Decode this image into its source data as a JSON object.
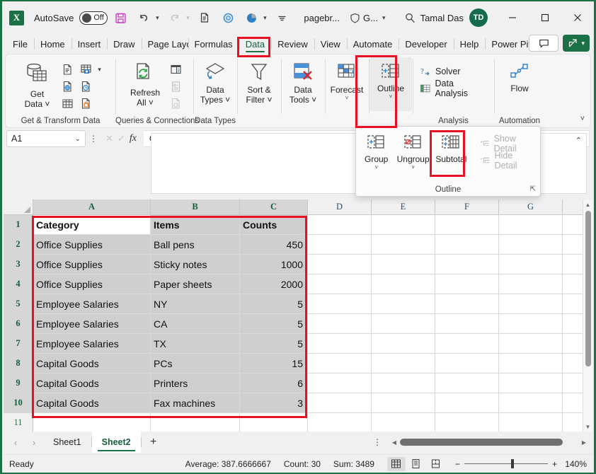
{
  "titlebar": {
    "app_icon": "excel-logo-icon",
    "autosave_label": "AutoSave",
    "autosave_state": "Off",
    "save_icon": "save-icon",
    "undo_icon": "undo-icon",
    "redo_icon": "redo-icon",
    "print_icon": "print-preview-icon",
    "touch_icon": "touch-mode-icon",
    "chart_icon": "pie-chart-icon",
    "more_icon": "more-commands-icon",
    "doc_title": "pagebr...",
    "shield_icon": "shield-icon",
    "autosave_group": "G...",
    "search_icon": "search-icon",
    "user_name": "Tamal Das",
    "user_initials": "TD",
    "minimize": "minimize-icon",
    "maximize": "maximize-icon",
    "close": "close-icon"
  },
  "ribbon_tabs": {
    "items": [
      {
        "label": "File",
        "active": false
      },
      {
        "label": "Home",
        "active": false
      },
      {
        "label": "Insert",
        "active": false
      },
      {
        "label": "Draw",
        "active": false
      },
      {
        "label": "Page Layout",
        "active": false
      },
      {
        "label": "Formulas",
        "active": false
      },
      {
        "label": "Data",
        "active": true
      },
      {
        "label": "Review",
        "active": false
      },
      {
        "label": "View",
        "active": false
      },
      {
        "label": "Automate",
        "active": false
      },
      {
        "label": "Developer",
        "active": false
      },
      {
        "label": "Help",
        "active": false
      },
      {
        "label": "Power Pivot",
        "active": false
      }
    ],
    "comments_label": "comment-icon",
    "share_label": "share-icon"
  },
  "ribbon": {
    "groups": [
      {
        "name": "Get & Transform Data",
        "main_button": {
          "label": "Get\nData",
          "icon": "get-data-icon",
          "has_caret": true
        },
        "small_buttons": [
          "from-text-csv-icon",
          "from-web-icon",
          "from-table-range-icon",
          "from-picture-icon",
          "recent-sources-icon",
          "existing-connections-icon"
        ]
      },
      {
        "name": "Queries & Connections",
        "main_button": {
          "label": "Refresh\nAll",
          "icon": "refresh-all-icon",
          "has_caret": true
        },
        "small_buttons": [
          "queries-connections-icon",
          "properties-icon",
          "edit-links-icon"
        ]
      },
      {
        "name": "Data Types",
        "main_button": {
          "label": "Data\nTypes",
          "icon": "data-types-icon",
          "has_caret": true
        }
      },
      {
        "name": "",
        "main_button": {
          "label": "Sort &\nFilter",
          "icon": "sort-filter-icon",
          "has_caret": true
        }
      },
      {
        "name": "",
        "main_button": {
          "label": "Data\nTools",
          "icon": "data-tools-icon",
          "has_caret": true
        }
      },
      {
        "name": "",
        "main_button": {
          "label": "Forecast",
          "icon": "forecast-icon",
          "has_caret": true
        }
      },
      {
        "name": "",
        "main_button": {
          "label": "Outline",
          "icon": "outline-icon",
          "has_caret": true,
          "highlighted": true
        }
      },
      {
        "name": "Analysis",
        "menu_items": [
          {
            "label": "Solver",
            "icon": "solver-icon",
            "disabled": false
          },
          {
            "label": "Data Analysis",
            "icon": "data-analysis-icon",
            "disabled": false
          }
        ]
      },
      {
        "name": "Automation",
        "main_button": {
          "label": "Flow",
          "icon": "flow-icon",
          "has_caret": false
        }
      }
    ],
    "collapse_icon": "collapse-ribbon-icon"
  },
  "outline_flyout": {
    "group_name": "Outline",
    "buttons": [
      {
        "label": "Group",
        "icon": "group-icon",
        "has_caret": true,
        "disabled": false,
        "highlighted": false
      },
      {
        "label": "Ungroup",
        "icon": "ungroup-icon",
        "has_caret": true,
        "disabled": false,
        "highlighted": false
      },
      {
        "label": "Subtotal",
        "icon": "subtotal-icon",
        "has_caret": false,
        "disabled": false,
        "highlighted": true
      }
    ],
    "menu_items": [
      {
        "label": "Show Detail",
        "icon": "show-detail-icon",
        "disabled": true
      },
      {
        "label": "Hide Detail",
        "icon": "hide-detail-icon",
        "disabled": true
      }
    ],
    "dialog_launcher": "dialog-launcher-icon"
  },
  "formula_bar": {
    "name_box_value": "A1",
    "name_box_caret": "chevron-down-icon",
    "cancel_icon": "cancel-icon",
    "enter_icon": "enter-icon",
    "fx_icon": "insert-function-icon",
    "content": "Category",
    "expand_icon": "collapse-formula-bar-icon"
  },
  "grid": {
    "columns": [
      "A",
      "B",
      "C",
      "D",
      "E",
      "F",
      "G"
    ],
    "selected_columns": [
      "A",
      "B",
      "C"
    ],
    "rows": [
      1,
      2,
      3,
      4,
      5,
      6,
      7,
      8,
      9,
      10,
      11
    ],
    "selected_rows": [
      1,
      2,
      3,
      4,
      5,
      6,
      7,
      8,
      9,
      10
    ],
    "active_cell": "A1",
    "headers": [
      "Category",
      "Items",
      "Counts"
    ],
    "data": [
      [
        "Office Supplies",
        "Ball pens",
        "450"
      ],
      [
        "Office Supplies",
        "Sticky notes",
        "1000"
      ],
      [
        "Office Supplies",
        "Paper sheets",
        "2000"
      ],
      [
        "Employee Salaries",
        "NY",
        "5"
      ],
      [
        "Employee Salaries",
        "CA",
        "5"
      ],
      [
        "Employee Salaries",
        "TX",
        "5"
      ],
      [
        "Capital Goods",
        "PCs",
        "15"
      ],
      [
        "Capital Goods",
        "Printers",
        "6"
      ],
      [
        "Capital Goods",
        "Fax machines",
        "3"
      ]
    ]
  },
  "sheet_tabs": {
    "prev_icon": "previous-sheet-icon",
    "next_icon": "next-sheet-icon",
    "tabs": [
      {
        "label": "Sheet1",
        "active": false
      },
      {
        "label": "Sheet2",
        "active": true
      }
    ],
    "add_label": "+",
    "options_icon": "sheet-options-icon"
  },
  "status_bar": {
    "mode": "Ready",
    "average": "Average: 387.6666667",
    "count": "Count: 30",
    "sum": "Sum: 3489",
    "view_normal": "normal-view-icon",
    "view_pagelayout": "page-layout-view-icon",
    "view_pagebreak": "page-break-preview-icon",
    "zoom_out": "−",
    "zoom_in": "+",
    "zoom_level": "140%"
  },
  "colors": {
    "accent": "#1a7145",
    "highlight": "#e81123",
    "selection": "#cfcfcf"
  }
}
